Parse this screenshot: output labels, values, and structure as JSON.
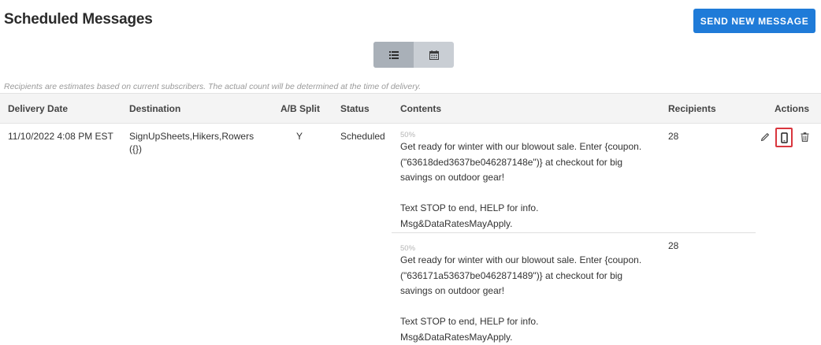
{
  "header": {
    "title": "Scheduled Messages",
    "send_button": "SEND NEW MESSAGE"
  },
  "view_toggle": {
    "options": [
      {
        "icon": "list-icon",
        "active": true
      },
      {
        "icon": "calendar-icon",
        "active": false
      }
    ]
  },
  "note": "Recipients are estimates based on current subscribers. The actual count will be determined at the time of delivery.",
  "table": {
    "columns": [
      "Delivery Date",
      "Destination",
      "A/B Split",
      "Status",
      "Contents",
      "Recipients",
      "Actions"
    ],
    "rows": [
      {
        "delivery_date": "11/10/2022 4:08 PM EST",
        "destination": "SignUpSheets,Hikers,Rowers",
        "destination_extra": "({})",
        "ab_split": "Y",
        "status": "Scheduled",
        "variants": [
          {
            "percent": "50%",
            "text": "Get ready for winter with our blowout sale. Enter {coupon.\n(\"63618ded3637be046287148e\")} at checkout for big\nsavings on outdoor gear!\n\nText STOP to end, HELP for info.\nMsg&DataRatesMayApply.",
            "recipients": "28"
          },
          {
            "percent": "50%",
            "text": "Get ready for winter with our blowout sale. Enter {coupon.\n(\"636171a53637be0462871489\")} at checkout for big\nsavings on outdoor gear!\n\nText STOP to end, HELP for info.\nMsg&DataRatesMayApply.",
            "recipients": "28"
          }
        ],
        "actions": [
          {
            "icon": "pencil-icon",
            "name": "edit"
          },
          {
            "icon": "phone-icon",
            "name": "preview",
            "highlighted": true
          },
          {
            "icon": "trash-icon",
            "name": "delete"
          }
        ]
      }
    ]
  },
  "colors": {
    "accent": "#1f7bd8",
    "highlight": "#d9363e",
    "header_bg": "#f4f4f4"
  }
}
